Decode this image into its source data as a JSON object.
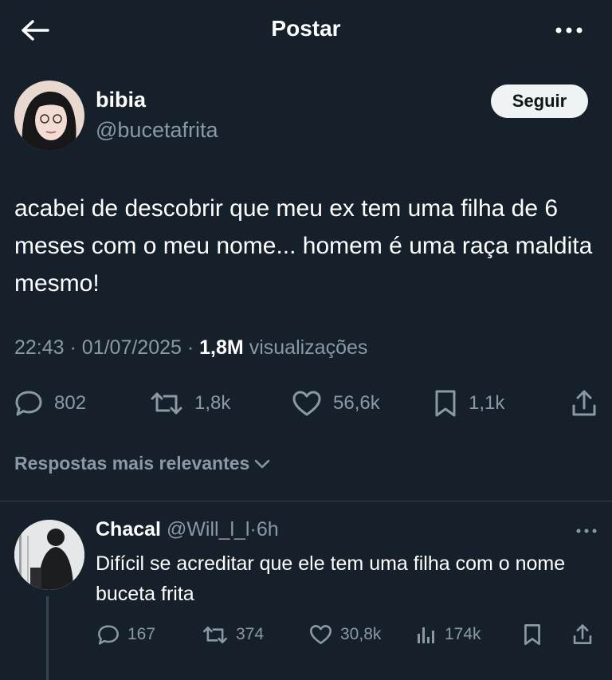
{
  "header": {
    "title": "Postar"
  },
  "tweet": {
    "author_name": "bibia",
    "author_handle": "@bucetafrita",
    "follow_label": "Seguir",
    "text": "acabei de descobrir que meu ex tem uma filha de 6 meses com o meu nome... homem é uma raça maldita mesmo!",
    "time": "22:43",
    "date": "01/07/2025",
    "views_count": "1,8M",
    "views_label": "visualizações",
    "separator": "·",
    "stats": {
      "replies": "802",
      "reposts": "1,8k",
      "likes": "56,6k",
      "bookmarks": "1,1k"
    }
  },
  "replies_sort": {
    "label": "Respostas mais relevantes"
  },
  "reply": {
    "name": "Chacal",
    "handle": "@Will_l_l",
    "dot": "·",
    "time": "6h",
    "text": "Difícil se acreditar que ele tem uma filha com o nome buceta frita",
    "stats": {
      "replies": "167",
      "reposts": "374",
      "likes": "30,8k",
      "views": "174k"
    }
  },
  "icons": {
    "back": "arrow-left-icon",
    "more": "ellipsis-icon",
    "reply": "speech-bubble-icon",
    "repost": "repost-icon",
    "like": "heart-icon",
    "bookmark": "bookmark-icon",
    "share": "share-icon",
    "views": "bar-chart-icon",
    "chevron": "chevron-down-icon"
  },
  "colors": {
    "background": "#15202b",
    "text_primary": "#ffffff",
    "text_secondary": "#8b98a5",
    "divider": "#38444d",
    "follow_bg": "#eff3f4"
  }
}
